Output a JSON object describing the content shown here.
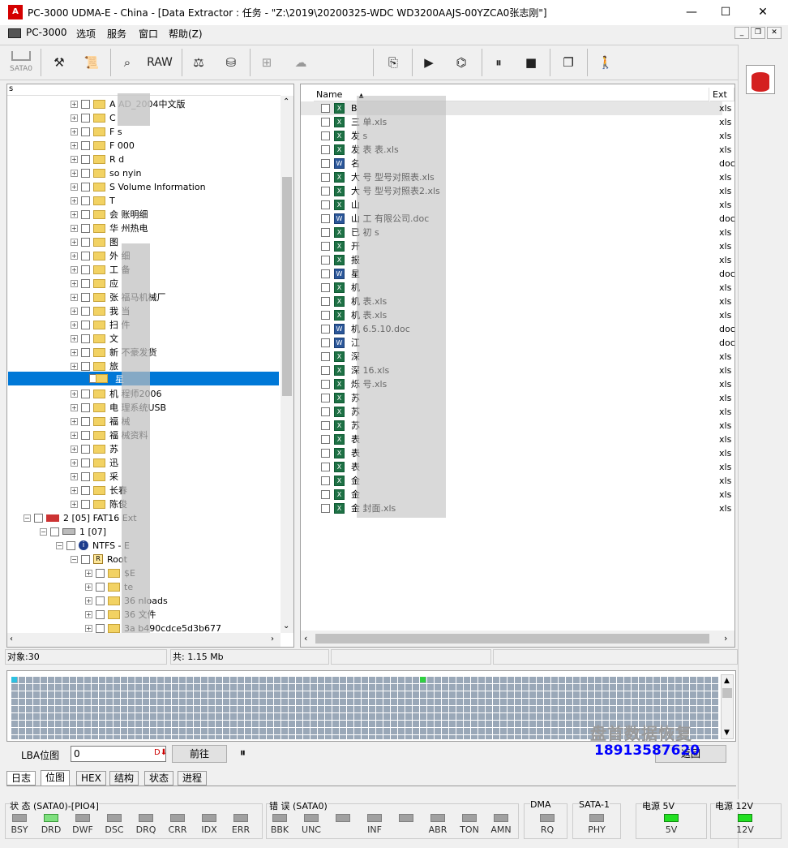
{
  "window": {
    "title": "PC-3000 UDMA-E - China - [Data Extractor : 任务 - \"Z:\\2019\\20200325-WDC WD3200AAJS-00YZCA0张志刚\"]",
    "controls": [
      "—",
      "☐",
      "✕"
    ]
  },
  "menu": [
    "PC-3000",
    "选项",
    "服务",
    "窗口",
    "帮助(Z)"
  ],
  "mdi_controls": [
    "_",
    "❐",
    "✕"
  ],
  "toolbar": {
    "sata_label": "SATA0",
    "raw_label": "RAW"
  },
  "tree": {
    "header": "s",
    "folders": [
      "A         AD_2004中文版",
      "C",
      "F           s",
      "F           000",
      "R           d",
      "so         nyin",
      "S            Volume Information",
      "T",
      "会         账明细",
      "华         州热电",
      "图",
      "外        细",
      "工         备",
      "应",
      "张         福马机械厂",
      "我         当",
      "扫         件",
      "文",
      "新         不豪发货",
      "旅"
    ],
    "selected": "星",
    "folders2": [
      "机         程师2006",
      "电         理系统USB",
      "福         械",
      "福         械资料",
      "苏",
      "迅",
      "采",
      "长春",
      "陈俊"
    ],
    "partition": "2 [05] FAT16 Ext",
    "volume": "1 [07]",
    "ntfs": "NTFS - E",
    "root": "Root",
    "rootfolders": [
      "$E",
      "te",
      "36        nloads",
      "36        文件",
      "3a         b490cdce5d3b677"
    ]
  },
  "filelist": {
    "col_name": "Name",
    "col_ext": "Ext",
    "files": [
      {
        "name": "B",
        "ext": "xls",
        "type": "xls"
      },
      {
        "name": "三                         单.xls",
        "ext": "xls",
        "type": "xls"
      },
      {
        "name": "发                         s",
        "ext": "xls",
        "type": "xls"
      },
      {
        "name": "发                         表         表.xls",
        "ext": "xls",
        "type": "xls"
      },
      {
        "name": "名",
        "ext": "doc",
        "type": "doc"
      },
      {
        "name": "大                         号          型号对照表.xls",
        "ext": "xls",
        "type": "xls"
      },
      {
        "name": "大                         号          型号对照表2.xls",
        "ext": "xls",
        "type": "xls"
      },
      {
        "name": "山",
        "ext": "xls",
        "type": "xls"
      },
      {
        "name": "山                         工          有限公司.doc",
        "ext": "doc",
        "type": "doc"
      },
      {
        "name": "已                         初          s",
        "ext": "xls",
        "type": "xls"
      },
      {
        "name": "开",
        "ext": "xls",
        "type": "xls"
      },
      {
        "name": "报",
        "ext": "xls",
        "type": "xls"
      },
      {
        "name": "星",
        "ext": "doc",
        "type": "doc"
      },
      {
        "name": "机",
        "ext": "xls",
        "type": "xls"
      },
      {
        "name": "机                                   表.xls",
        "ext": "xls",
        "type": "xls"
      },
      {
        "name": "机                                   表.xls",
        "ext": "xls",
        "type": "xls"
      },
      {
        "name": "机                                   6.5.10.doc",
        "ext": "doc",
        "type": "doc"
      },
      {
        "name": "江",
        "ext": "doc",
        "type": "doc"
      },
      {
        "name": "深",
        "ext": "xls",
        "type": "xls"
      },
      {
        "name": "深                                   16.xls",
        "ext": "xls",
        "type": "xls"
      },
      {
        "name": "烁                                   号.xls",
        "ext": "xls",
        "type": "xls"
      },
      {
        "name": "苏",
        "ext": "xls",
        "type": "xls"
      },
      {
        "name": "苏",
        "ext": "xls",
        "type": "xls"
      },
      {
        "name": "苏",
        "ext": "xls",
        "type": "xls"
      },
      {
        "name": "表",
        "ext": "xls",
        "type": "xls"
      },
      {
        "name": "表",
        "ext": "xls",
        "type": "xls"
      },
      {
        "name": "表",
        "ext": "xls",
        "type": "xls"
      },
      {
        "name": "金",
        "ext": "xls",
        "type": "xls"
      },
      {
        "name": "金",
        "ext": "xls",
        "type": "xls"
      },
      {
        "name": "金                                     封面.xls",
        "ext": "xls",
        "type": "xls"
      }
    ]
  },
  "status": {
    "objects": "对象:30",
    "total": "共: 1.15 Mb"
  },
  "lba": {
    "label": "LBA位图",
    "value": "0",
    "goto": "前往",
    "pause": "⏸",
    "right_btn": "返回"
  },
  "watermark": {
    "line1": "盘首数据恢复",
    "line2": "18913587620"
  },
  "tabs": [
    "日志",
    "位图",
    "HEX",
    "结构",
    "状态",
    "进程"
  ],
  "indicators": {
    "status_group": "状 态 (SATA0)-[PIO4]",
    "status_leds": [
      "BSY",
      "DRD",
      "DWF",
      "DSC",
      "DRQ",
      "CRR",
      "IDX",
      "ERR"
    ],
    "status_on": "DRD",
    "error_group": "错 误 (SATA0)",
    "error_leds": [
      "BBK",
      "UNC",
      "",
      "INF",
      "",
      "ABR",
      "TON",
      "AMN"
    ],
    "dma_group": "DMA",
    "dma_leds": [
      "RQ"
    ],
    "sata_group": "SATA-1",
    "sata_leds": [
      "PHY"
    ],
    "power5_group": "电源 5V",
    "power5_leds": [
      "5V"
    ],
    "power12_group": "电源 12V",
    "power12_leds": [
      "12V"
    ]
  }
}
